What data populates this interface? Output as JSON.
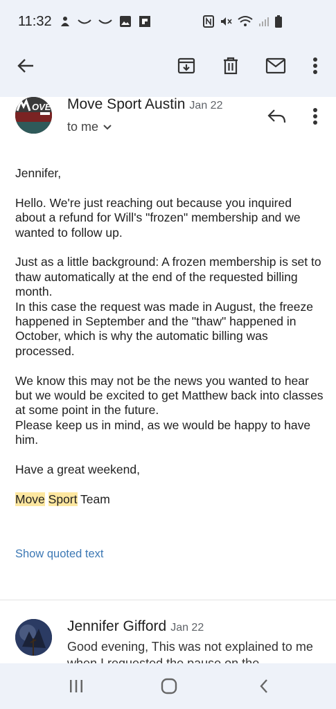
{
  "status": {
    "time": "11:32",
    "left_icons": [
      "notification-icon",
      "missed-call-icon",
      "missed-call-icon",
      "gallery-icon",
      "flipboard-icon"
    ],
    "right_icons": [
      "nfc-icon",
      "mute-icon",
      "wifi-icon",
      "signal-icon",
      "battery-icon"
    ]
  },
  "appbar": {
    "actions": [
      "back-icon",
      "archive-icon",
      "delete-icon",
      "mail-icon",
      "more-vert-icon"
    ]
  },
  "email": {
    "sender": "Move Sport Austin",
    "date": "Jan 22",
    "recipient": "to me",
    "greeting": "Jennifer,",
    "paragraphs": [
      "Hello. We're just reaching out because you inquired about a refund for Will's \"frozen\" membership and we wanted to follow up.",
      "Just as a little background: A frozen membership is set to thaw automatically at the end of the requested billing month.",
      "In this case the request was made in August, the freeze happened in September and the \"thaw\" happened in October, which is why the automatic billing was processed.",
      "We know this may not be the news you wanted to hear but we would be excited to get Matthew back into classes at some point in the future.",
      "Please keep us in mind, as we would be happy to have him.",
      "Have a great weekend,"
    ],
    "signature_move": "Move",
    "signature_sport": "Sport",
    "signature_team": "Team",
    "show_quoted": "Show quoted text"
  },
  "next_message": {
    "sender": "Jennifer Gifford",
    "date": "Jan 22",
    "snippet": "Good evening, This was not explained to me when I requested the pause on the"
  },
  "colors": {
    "bar_bg": "#eef2f9",
    "highlight": "#fde7a0",
    "link": "#3c78b4"
  }
}
